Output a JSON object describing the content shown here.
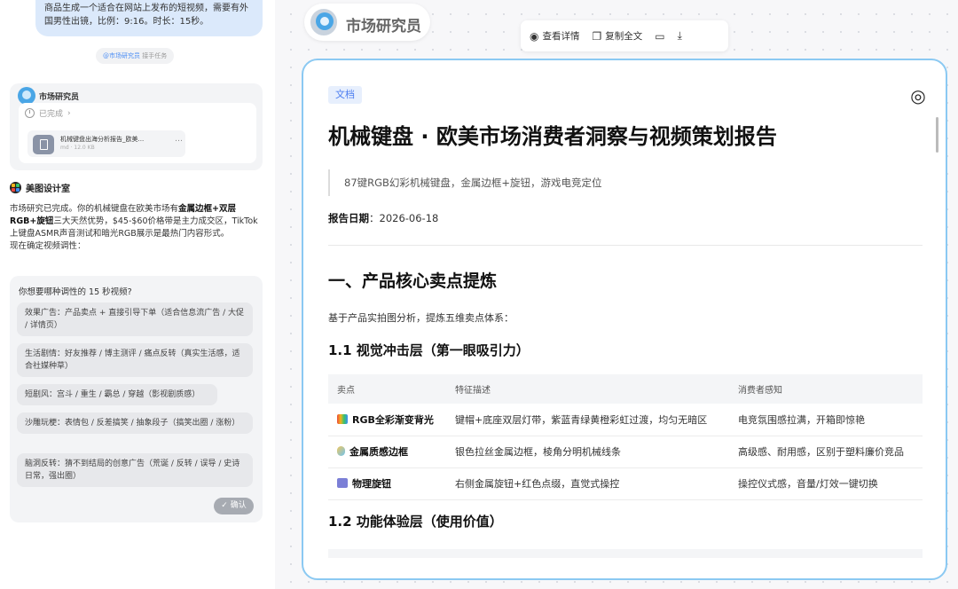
{
  "chat": {
    "user_message": "商品生成一个适合在网站上发布的短视频，需要有外国男性出镜，比例：9:16。时长：15秒。",
    "mention": {
      "name": "@市场研究员",
      "suffix": "接手任务"
    },
    "agent": {
      "name": "市场研究员",
      "status": "已完成",
      "file": {
        "name": "机械键盘出海分析报告_欧美...",
        "meta": "md · 12.0 KB",
        "more": "…"
      }
    },
    "designer": {
      "name": "美图设计室",
      "msg_a": "市场研究已完成。你的机械键盘在欧美市场有",
      "msg_b": "金属边框+双层RGB+旋钮",
      "msg_c": "三大天然优势，$45-$60价格带是主力成交区，TikTok上键盘ASMR声音测试和暗光RGB展示是最热门内容形式。",
      "msg_d": "现在确定视频调性："
    },
    "question": {
      "title": "你想要哪种调性的 15 秒视频?",
      "options": [
        "效果广告：产品卖点 + 直接引导下单（适合信息流广告 / 大促 / 详情页）",
        "生活剧情：好友推荐 / 博主测评 / 痛点反转（真实生活感，适合社媒种草）",
        "短剧风：宫斗 / 重生 / 霸总 / 穿越（影视剧质感）",
        "沙雕玩梗：表情包 / 反差搞笑 / 抽象段子（搞笑出圈 / 涨粉）",
        "脑洞反转：猜不到结局的创意广告（荒诞 / 反转 / 误导 / 史诗日常，强出圈）"
      ],
      "confirm": "✓ 确认"
    }
  },
  "viewer": {
    "agent_name": "市场研究员",
    "toolbar": {
      "view": "查看详情",
      "copy": "复制全文"
    }
  },
  "doc": {
    "tag": "文档",
    "title": "机械键盘 · 欧美市场消费者洞察与视频策划报告",
    "quote": "87键RGB幻彩机械键盘，金属边框+旋钮，游戏电竞定位",
    "date_label": "报告日期",
    "date_value": "：2026-06-18",
    "h1": "一、产品核心卖点提炼",
    "para": "基于产品实拍图分析，提炼五维卖点体系：",
    "h2a": "1.1 视觉冲击层（第一眼吸引力）",
    "table": {
      "headers": [
        "卖点",
        "特征描述",
        "消费者感知"
      ],
      "rows": [
        {
          "k": "RGB全彩渐变背光",
          "d": "键帽+底座双层灯带，紫蓝青绿黄橙彩虹过渡，均匀无暗区",
          "p": "电竞氛围感拉满，开箱即惊艳"
        },
        {
          "k": "金属质感边框",
          "d": "银色拉丝金属边框，棱角分明机械线条",
          "p": "高级感、耐用感，区别于塑料廉价竞品"
        },
        {
          "k": "物理旋钮",
          "d": "右侧金属旋钮+红色点缀，直觉式操控",
          "p": "操控仪式感，音量/灯效一键切换"
        }
      ]
    },
    "h2b": "1.2 功能体验层（使用价值）"
  },
  "colors": {
    "accent": "#4c7df0",
    "bubble": "#dbe9fb",
    "border": "#8bc9f2"
  }
}
